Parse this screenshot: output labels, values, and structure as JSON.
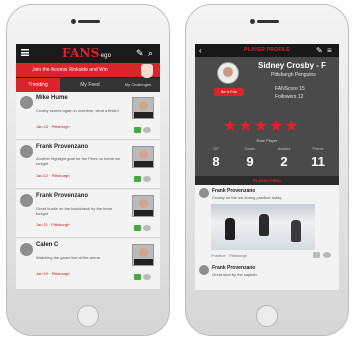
{
  "left_screen": {
    "logo": "FANS",
    "logo_suffix": "ego",
    "banner": "Join the Acronis Rinkside and Win",
    "tabs": [
      "Trending",
      "My Feed",
      "My Challenges"
    ],
    "posts": [
      {
        "name": "Mike Hume",
        "text": "Crosby scores again in overtime, what a finish!",
        "time": "Jan 13 · Pittsburgh"
      },
      {
        "name": "Frank Provenzano",
        "text": "Another highlight goal for the Pens on home ice tonight",
        "time": "Jan 12 · Pittsburgh"
      },
      {
        "name": "Frank Provenzano",
        "text": "Great hustle on the backcheck by the team tonight",
        "time": "Jan 11 · Pittsburgh"
      },
      {
        "name": "Calen C",
        "text": "Watching the game live at the arena",
        "time": "Jan 10 · Pittsburgh"
      }
    ]
  },
  "right_screen": {
    "header": "PLAYER PROFILE",
    "player_name": "Sidney Crosby - F",
    "team": "Pittsburgh Penguins",
    "fanscore": "FANScore 15",
    "followers": "Followers 12",
    "fan_button": "Be a Fan",
    "stars": "★★★★★",
    "rate_label": "Rate Player",
    "stats_labels": [
      "GP",
      "Goals",
      "Assists",
      "Points"
    ],
    "stats_values": [
      "8",
      "9",
      "2",
      "11"
    ],
    "section_title": "PLAYER FEED",
    "post_name": "Frank Provenzano",
    "post_text": "Crosby on the ice during practice today",
    "post_footer": "Practice · Pittsburgh",
    "post2_name": "Frank Provenzano",
    "post2_text": "Great shot by the captain"
  }
}
